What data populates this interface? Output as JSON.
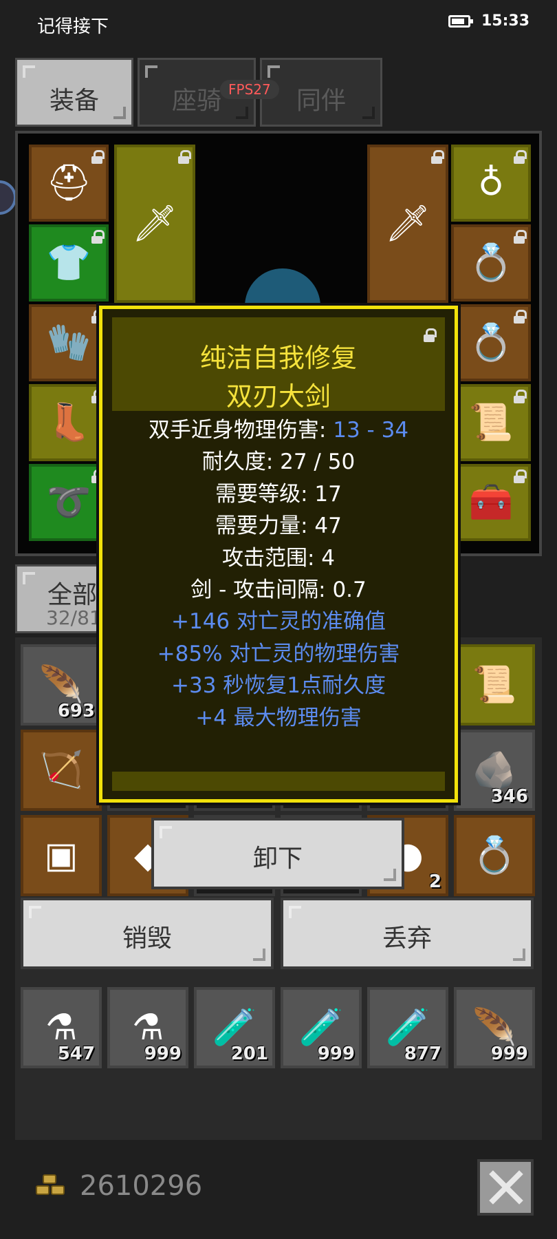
{
  "status_bar": {
    "title": "记得接下",
    "time": "15:33"
  },
  "tabs": [
    {
      "label": "装备",
      "active": true
    },
    {
      "label": "座骑",
      "active": false
    },
    {
      "label": "同伴",
      "active": false
    }
  ],
  "fps": "FPS27",
  "equipment": {
    "left": [
      {
        "icon": "helmet-icon",
        "glyph": "⛑",
        "color": "orange"
      },
      {
        "icon": "armor-icon",
        "glyph": "👕",
        "color": "green"
      },
      {
        "icon": "gloves-icon",
        "glyph": "🧤",
        "color": "orange"
      },
      {
        "icon": "boots-icon",
        "glyph": "👢",
        "color": "yellow"
      },
      {
        "icon": "belt-icon",
        "glyph": "➰",
        "color": "green"
      }
    ],
    "right": [
      {
        "icon": "amulet-icon",
        "glyph": "♁",
        "color": "yellow"
      },
      {
        "icon": "ring-icon",
        "glyph": "💍",
        "color": "orange"
      },
      {
        "icon": "ring-icon",
        "glyph": "💍",
        "color": "orange"
      },
      {
        "icon": "scroll-icon",
        "glyph": "📜",
        "color": "yellow"
      },
      {
        "icon": "chest-icon",
        "glyph": "🧰",
        "color": "yellow"
      }
    ]
  },
  "bag_filter": {
    "label": "全部",
    "capacity": "32/81"
  },
  "bag_rows": [
    [
      {
        "icon": "feather-icon",
        "glyph": "🪶",
        "color": "gray",
        "count": "693"
      },
      null,
      null,
      null,
      null,
      {
        "icon": "scroll-icon",
        "glyph": "📜",
        "color": "yellow",
        "count": ""
      }
    ],
    [
      {
        "icon": "crossbow-icon",
        "glyph": "🏹",
        "color": "orange",
        "count": ""
      },
      null,
      null,
      null,
      null,
      {
        "icon": "ore-icon",
        "glyph": "🪨",
        "color": "gray",
        "count": "346"
      }
    ],
    [
      {
        "icon": "cloth-icon",
        "glyph": "▣",
        "color": "orange",
        "count": ""
      },
      {
        "icon": "gem-icon",
        "glyph": "◆",
        "color": "orange",
        "count": ""
      },
      null,
      null,
      {
        "icon": "gem-icon",
        "glyph": "●",
        "color": "orange",
        "count": "2"
      },
      {
        "icon": "ring-icon",
        "glyph": "💍",
        "color": "orange",
        "count": ""
      }
    ],
    [
      {
        "icon": "potion-icon",
        "glyph": "⚗",
        "color": "gray",
        "count": "547"
      },
      {
        "icon": "potion-icon",
        "glyph": "⚗",
        "color": "gray",
        "count": "999"
      },
      {
        "icon": "potion-icon",
        "glyph": "🧪",
        "color": "gray",
        "count": "201"
      },
      {
        "icon": "potion-icon",
        "glyph": "🧪",
        "color": "gray",
        "count": "999"
      },
      {
        "icon": "potion-icon",
        "glyph": "🧪",
        "color": "gray",
        "count": "877"
      },
      {
        "icon": "feather-icon",
        "glyph": "🪶",
        "color": "gray",
        "count": "999"
      }
    ]
  ],
  "tooltip": {
    "name": "纯洁自我修复",
    "type": "双刃大剑",
    "damage_label": "双手近身物理伤害: ",
    "damage_value": "13 - 34",
    "durability": "耐久度: 27 / 50",
    "level_req": "需要等级: 17",
    "str_req": "需要力量: 47",
    "range": "攻击范围: 4",
    "interval": "剑 - 攻击间隔: 0.7",
    "bonuses": [
      "+146 对亡灵的准确值",
      "+85% 对亡灵的物理伤害",
      "+33 秒恢复1点耐久度",
      "+4 最大物理伤害"
    ]
  },
  "actions": {
    "unequip": "卸下",
    "destroy": "销毁",
    "discard": "丢弃"
  },
  "gold": "2610296"
}
